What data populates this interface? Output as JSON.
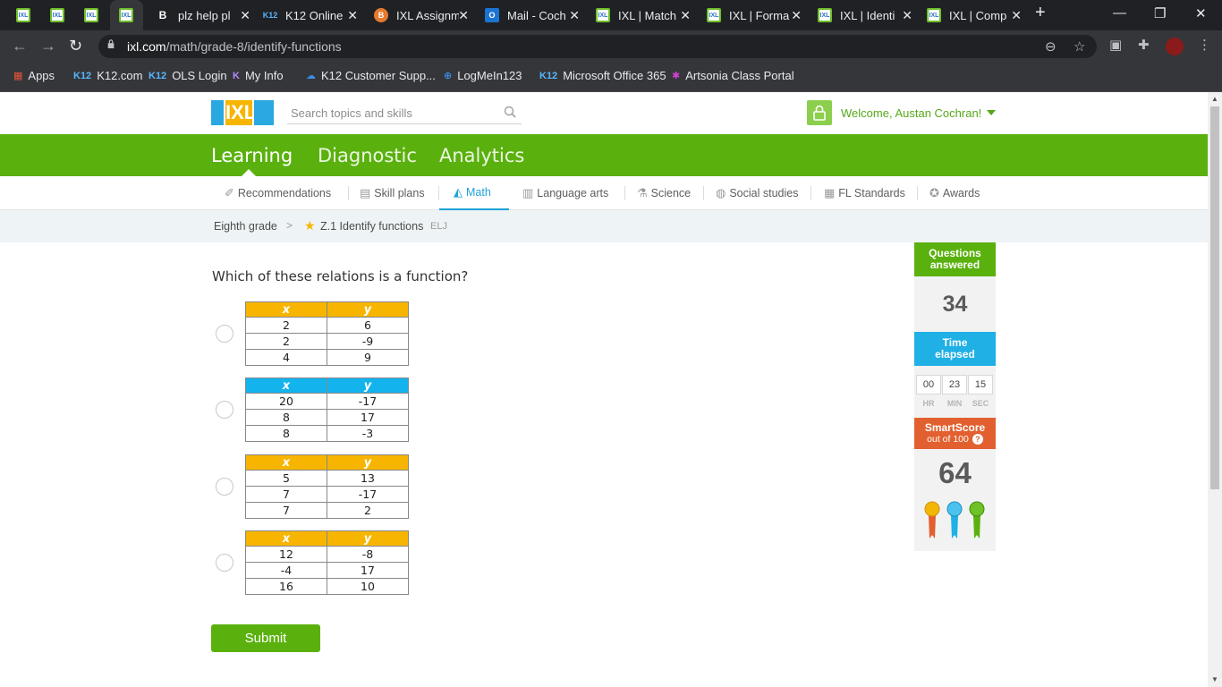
{
  "browser": {
    "tabs": [
      {
        "label": "",
        "favicon": "ixl"
      },
      {
        "label": "",
        "favicon": "ixl"
      },
      {
        "label": "",
        "favicon": "ixl"
      },
      {
        "label": "",
        "favicon": "ixl",
        "active": true
      },
      {
        "label": "plz help pl",
        "favicon": "brainly"
      },
      {
        "label": "K12 Online",
        "favicon": "k12"
      },
      {
        "label": "IXL Assignm",
        "favicon": "bitcoin"
      },
      {
        "label": "Mail - Coch",
        "favicon": "outlook"
      },
      {
        "label": "IXL | Match",
        "favicon": "ixl"
      },
      {
        "label": "IXL | Forma",
        "favicon": "ixl"
      },
      {
        "label": "IXL | Identi",
        "favicon": "ixl"
      },
      {
        "label": "IXL | Comp",
        "favicon": "ixl"
      }
    ],
    "url_domain": "ixl.com",
    "url_path": "/math/grade-8/identify-functions",
    "bookmarks": [
      "Apps",
      "K12.com",
      "OLS Login",
      "My Info",
      "K12 Customer Supp...",
      "LogMeIn123",
      "Microsoft Office 365",
      "Artsonia Class Portal"
    ]
  },
  "header": {
    "logo_text": "IXL",
    "search_placeholder": "Search topics and skills",
    "welcome": "Welcome, Austan Cochran!"
  },
  "main_nav": [
    "Learning",
    "Diagnostic",
    "Analytics"
  ],
  "sub_nav": [
    {
      "label": "Recommendations",
      "icon": "recommendations-icon"
    },
    {
      "label": "Skill plans",
      "icon": "skill-plans-icon"
    },
    {
      "label": "Math",
      "icon": "math-icon",
      "active": true
    },
    {
      "label": "Language arts",
      "icon": "book-icon"
    },
    {
      "label": "Science",
      "icon": "flask-icon"
    },
    {
      "label": "Social studies",
      "icon": "globe-icon"
    },
    {
      "label": "FL Standards",
      "icon": "standards-icon"
    },
    {
      "label": "Awards",
      "icon": "awards-icon"
    }
  ],
  "breadcrumb": {
    "grade": "Eighth grade",
    "skill": "Z.1 Identify functions",
    "code": "ELJ"
  },
  "question": "Which of these relations is a function?",
  "options": [
    {
      "header_color": "#f7b500",
      "col_x": "x",
      "col_y": "y",
      "rows": [
        [
          "2",
          "6"
        ],
        [
          "2",
          "-9"
        ],
        [
          "4",
          "9"
        ]
      ]
    },
    {
      "header_color": "#13b4ee",
      "col_x": "x",
      "col_y": "y",
      "rows": [
        [
          "20",
          "-17"
        ],
        [
          "8",
          "17"
        ],
        [
          "8",
          "-3"
        ]
      ]
    },
    {
      "header_color": "#f7b500",
      "col_x": "x",
      "col_y": "y",
      "rows": [
        [
          "5",
          "13"
        ],
        [
          "7",
          "-17"
        ],
        [
          "7",
          "2"
        ]
      ]
    },
    {
      "header_color": "#f7b500",
      "col_x": "x",
      "col_y": "y",
      "rows": [
        [
          "12",
          "-8"
        ],
        [
          "-4",
          "17"
        ],
        [
          "16",
          "10"
        ]
      ]
    }
  ],
  "submit_label": "Submit",
  "side": {
    "questions_line1": "Questions",
    "questions_line2": "answered",
    "questions_value": "34",
    "time_line1": "Time",
    "time_line2": "elapsed",
    "time_hr": "00",
    "time_min": "23",
    "time_sec": "15",
    "hr_label": "HR",
    "min_label": "MIN",
    "sec_label": "SEC",
    "smartscore_line1": "SmartScore",
    "smartscore_line2": "out of 100",
    "smartscore_value": "64"
  },
  "colors": {
    "brand_green": "#5ab10e",
    "accent_blue": "#1da2d8",
    "smartscore_orange": "#e2602f"
  }
}
